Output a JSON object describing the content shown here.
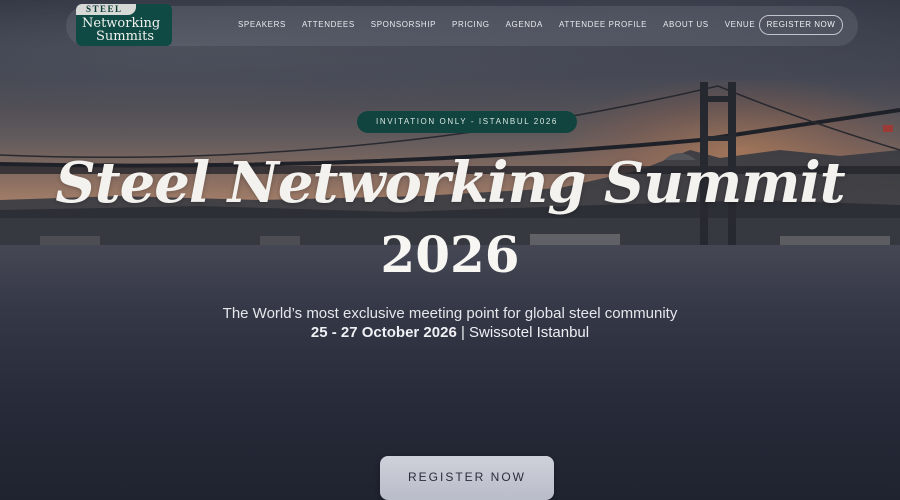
{
  "nav": {
    "logo": {
      "top": "STEEL",
      "line1": "Networking",
      "line2": "Summits"
    },
    "links": [
      "SPEAKERS",
      "ATTENDEES",
      "SPONSORSHIP",
      "PRICING",
      "AGENDA",
      "ATTENDEE PROFILE",
      "ABOUT US",
      "VENUE"
    ],
    "register": "REGISTER NOW"
  },
  "hero": {
    "badge": "INVITATION ONLY - ISTANBUL 2026",
    "title": "Steel Networking Summit",
    "year": "2026",
    "tagline": "The World’s most exclusive meeting point for global steel community",
    "dates": "25 - 27 October 2026",
    "separator": "|",
    "venue": "Swissotel Istanbul",
    "cta": "REGISTER NOW"
  },
  "colors": {
    "brand": "#0f4a45",
    "badge": "#12443f",
    "cta": "#c6c9d4"
  }
}
